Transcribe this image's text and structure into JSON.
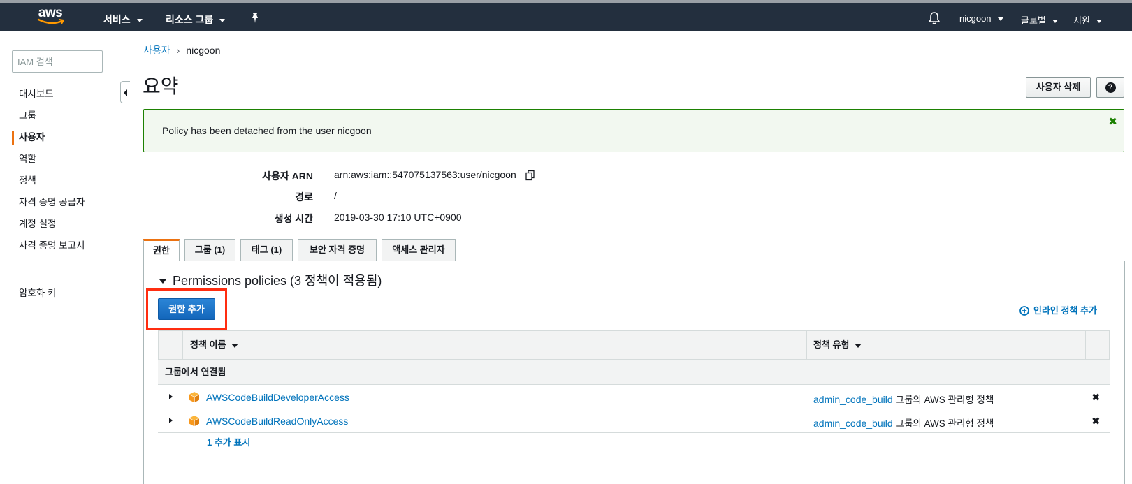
{
  "topbar": {
    "logo_text": "aws",
    "services_label": "서비스",
    "resource_groups_label": "리소스 그룹",
    "user_label": "nicgoon",
    "region_label": "글로벌",
    "support_label": "지원",
    "background_color": "#232f3e",
    "logo_smile_color": "#ff9900"
  },
  "sidebar": {
    "search_placeholder": "IAM 검색",
    "items": [
      {
        "label": "대시보드"
      },
      {
        "label": "그룹"
      },
      {
        "label": "사용자",
        "active": true
      },
      {
        "label": "역할"
      },
      {
        "label": "정책"
      },
      {
        "label": "자격 증명 공급자"
      },
      {
        "label": "계정 설정"
      },
      {
        "label": "자격 증명 보고서"
      }
    ],
    "kms_label": "암호화 키",
    "active_indicator_color": "#ec7211"
  },
  "breadcrumb": {
    "parent": "사용자",
    "current": "nicgoon"
  },
  "page": {
    "title": "요약",
    "delete_user_label": "사용자 삭제",
    "help_symbol": "?"
  },
  "alert": {
    "message": "Policy has been detached from the user nicgoon",
    "close_symbol": "✖",
    "border_color": "#1d8102"
  },
  "summary": {
    "arn_label": "사용자 ARN",
    "arn_value": "arn:aws:iam::547075137563:user/nicgoon",
    "path_label": "경로",
    "path_value": "/",
    "created_label": "생성 시간",
    "created_value": "2019-03-30 17:10 UTC+0900"
  },
  "tabs": [
    {
      "label": "권한",
      "active": true
    },
    {
      "label": "그룹 (1)"
    },
    {
      "label": "태그 (1)"
    },
    {
      "label": "보안 자격 증명"
    },
    {
      "label": "액세스 관리자"
    }
  ],
  "permissions": {
    "section_title": "Permissions policies (3 정책이 적용됨)",
    "add_permissions_label": "권한 추가",
    "add_inline_policy_label": "인라인 정책 추가",
    "columns": {
      "policy_name": "정책 이름",
      "policy_type": "정책 유형"
    },
    "group_header": "그룹에서 연결됨",
    "rows": [
      {
        "name": "AWSCodeBuildDeveloperAccess",
        "type_link": "admin_code_build",
        "type_text": "그룹의 AWS 관리형 정책",
        "detach_symbol": "✖"
      },
      {
        "name": "AWSCodeBuildReadOnlyAccess",
        "type_link": "admin_code_build",
        "type_text": "그룹의 AWS 관리형 정책",
        "detach_symbol": "✖"
      }
    ],
    "show_more_label": "1 추가 표시",
    "primary_button_color": "#1366bb",
    "highlight_color": "#ff2d10",
    "policy_icon_color": "#f7981d"
  }
}
